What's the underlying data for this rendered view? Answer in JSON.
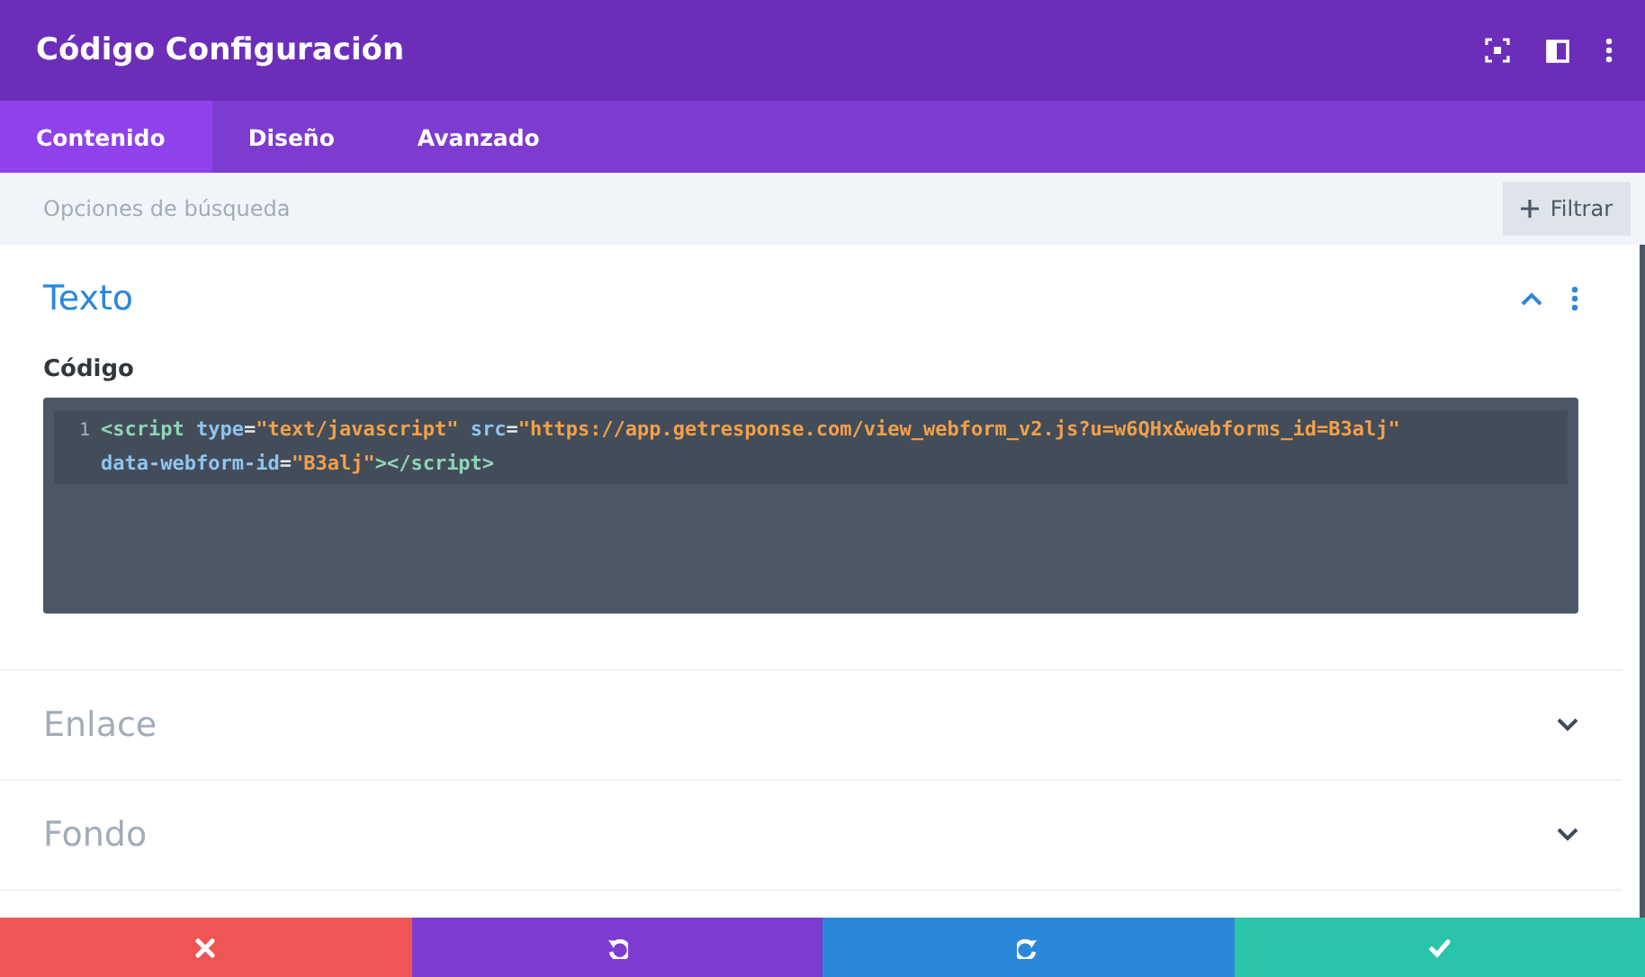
{
  "window": {
    "title": "Código Configuración"
  },
  "tabs": [
    {
      "label": "Contenido",
      "selected": true
    },
    {
      "label": "Diseño",
      "selected": false
    },
    {
      "label": "Avanzado",
      "selected": false
    }
  ],
  "search": {
    "placeholder": "Opciones de búsqueda",
    "filter_button": "Filtrar"
  },
  "sections": [
    {
      "title": "Texto",
      "expanded": true,
      "field_label": "Código",
      "code": {
        "line_number": "1",
        "wrapped_lines": [
          [
            {
              "kind": "tag",
              "text": "<script"
            },
            {
              "kind": "attr",
              "text": " type"
            },
            {
              "kind": "punct",
              "text": "="
            },
            {
              "kind": "string",
              "text": "\"text/javascript\""
            },
            {
              "kind": "attr",
              "text": " src"
            },
            {
              "kind": "punct",
              "text": "="
            },
            {
              "kind": "string",
              "text": "\"https://app.getresponse.com/view_webform_v2.js?u=w6QHx&webforms_id=B3alj\""
            }
          ],
          [
            {
              "kind": "attr",
              "text": "data-webform-id"
            },
            {
              "kind": "punct",
              "text": "="
            },
            {
              "kind": "string",
              "text": "\"B3alj\""
            },
            {
              "kind": "tag",
              "text": "></script>"
            }
          ]
        ]
      }
    },
    {
      "title": "Enlace",
      "expanded": false
    },
    {
      "title": "Fondo",
      "expanded": false
    }
  ],
  "footer_buttons": [
    {
      "kind": "cancel"
    },
    {
      "kind": "undo"
    },
    {
      "kind": "redo"
    },
    {
      "kind": "save"
    }
  ]
}
